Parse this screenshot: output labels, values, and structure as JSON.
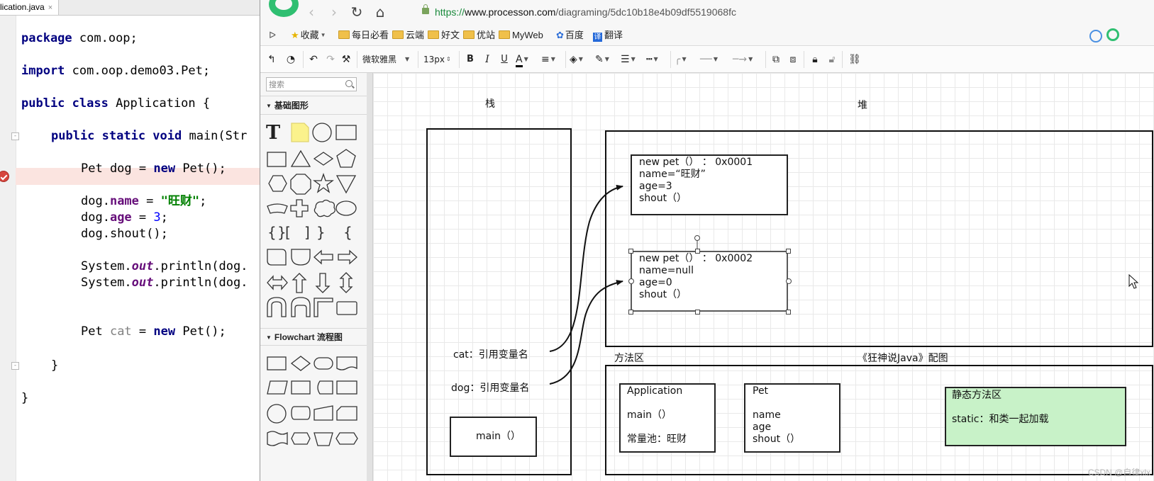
{
  "ide": {
    "tab_label": "lication.java",
    "tab_close": "×",
    "code": {
      "l1_kw": "package",
      "l1_rest": " com.oop;",
      "l2_kw": "import",
      "l2_rest": " com.oop.demo03.Pet;",
      "l3_kw": "public class",
      "l3_rest": " Application {",
      "l4_kw": "public static void",
      "l4_rest": " main(Str",
      "l5_a": "Pet dog = ",
      "l5_kw": "new",
      "l5_b": " Pet();",
      "l6_a": "dog.",
      "l6_fld": "name",
      "l6_b": " = ",
      "l6_str": "\"旺财\"",
      "l6_c": ";",
      "l7_a": "dog.",
      "l7_fld": "age",
      "l7_b": " = ",
      "l7_num": "3",
      "l7_c": ";",
      "l8": "dog.shout();",
      "l9_a": "System.",
      "l9_fld": "out",
      "l9_b": ".println(dog.",
      "l10_a": "System.",
      "l10_fld": "out",
      "l10_b": ".println(dog.",
      "l11_a": "Pet ",
      "l11_var": "cat",
      "l11_b": " = ",
      "l11_kw": "new",
      "l11_c": " Pet();",
      "l12": "}",
      "l13": "}"
    }
  },
  "browser": {
    "url_https": "https://",
    "url_host": "www.processon.com",
    "url_path": "/diagraming/5dc10b18e4b09df5519068fc",
    "bookmarks": {
      "toggle": "ᐅ",
      "fav": "收藏",
      "daily": "每日必看",
      "cloud": "云端",
      "good_articles": "好文",
      "good_sites": "优站",
      "myweb": "MyWeb",
      "baidu": "百度",
      "translate": "翻译"
    }
  },
  "toolbar": {
    "font_family": "微软雅黑",
    "font_size": "13px",
    "bold": "B",
    "italic": "I",
    "underline": "U",
    "font_color": "A"
  },
  "shape_panel": {
    "search_placeholder": "搜索",
    "section_basic": "基础图形",
    "section_flowchart": "Flowchart 流程图",
    "text_tool": "T"
  },
  "diagram": {
    "label_stack": "栈",
    "label_heap": "堆",
    "label_method_area": "方法区",
    "label_caption": "《狂神说Java》配图",
    "stack": {
      "cat_ref": "cat：引用变量名",
      "dog_ref": "dog：引用变量名",
      "main": "main（）"
    },
    "heap_obj1": {
      "line1": "new pet（）  ：  0x0001",
      "line2": "name=“旺财”",
      "line3": "age=3",
      "line4": "shout（）"
    },
    "heap_obj2": {
      "line1": "new pet（）  ：  0x0002",
      "line2": "name=null",
      "line3": "age=0",
      "line4": "shout（）"
    },
    "method_application": {
      "title": "Application",
      "line1": "main（）",
      "line2": "常量池：旺财"
    },
    "method_pet": {
      "title": "Pet",
      "line1": "name",
      "line2": "age",
      "line3": "shout（）"
    },
    "static_area": {
      "title": "静态方法区",
      "line1": "static：和类一起加载",
      "fill": "#c8f2c8"
    }
  },
  "watermark": "CSDN @自律xlx",
  "colors": {
    "keyword": "#000080",
    "string": "#008000",
    "field": "#660e7a",
    "number": "#0000ff",
    "breakpoint_line": "#fbe4e0",
    "static_area_fill": "#c8f2c8"
  }
}
